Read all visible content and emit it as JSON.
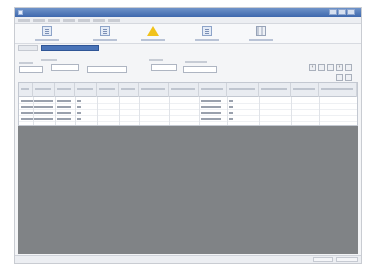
{
  "window": {
    "title": ""
  },
  "menu": {
    "items": [
      "",
      "",
      "",
      "",
      "",
      "",
      ""
    ]
  },
  "toolbar": {
    "buttons": [
      {
        "label": "",
        "icon": "document-icon"
      },
      {
        "label": "",
        "icon": "document-icon"
      },
      {
        "label": "",
        "icon": "warning-icon"
      },
      {
        "label": "",
        "icon": "document-icon"
      },
      {
        "label": "",
        "icon": "grid-icon"
      }
    ]
  },
  "tabs": {
    "previous_label": "",
    "selected_label": ""
  },
  "filter": {
    "labels": [
      "",
      "",
      "",
      ""
    ],
    "inputs": [
      "",
      "",
      "",
      ""
    ],
    "nav": {
      "prev": "‹",
      "next": "›"
    }
  },
  "table": {
    "headers": [
      "",
      "",
      "",
      "",
      "",
      "",
      "",
      "",
      "",
      "",
      "",
      "",
      ""
    ],
    "rows": [
      [
        "",
        "",
        "",
        "",
        "",
        "",
        "",
        "",
        "",
        "",
        "",
        "",
        ""
      ],
      [
        "",
        "",
        "",
        "",
        "",
        "",
        "",
        "",
        "",
        "",
        "",
        "",
        ""
      ],
      [
        "",
        "",
        "",
        "",
        "",
        "",
        "",
        "",
        "",
        "",
        "",
        "",
        ""
      ],
      [
        "",
        "",
        "",
        "",
        "",
        "",
        "",
        "",
        "",
        "",
        "",
        "",
        ""
      ]
    ]
  },
  "status": {
    "cells": [
      "",
      ""
    ]
  },
  "colors": {
    "titlebar": "#3e68ad",
    "selected_tab": "#4a74b8",
    "warning": "#f1c21b",
    "empty_area": "#808386"
  }
}
